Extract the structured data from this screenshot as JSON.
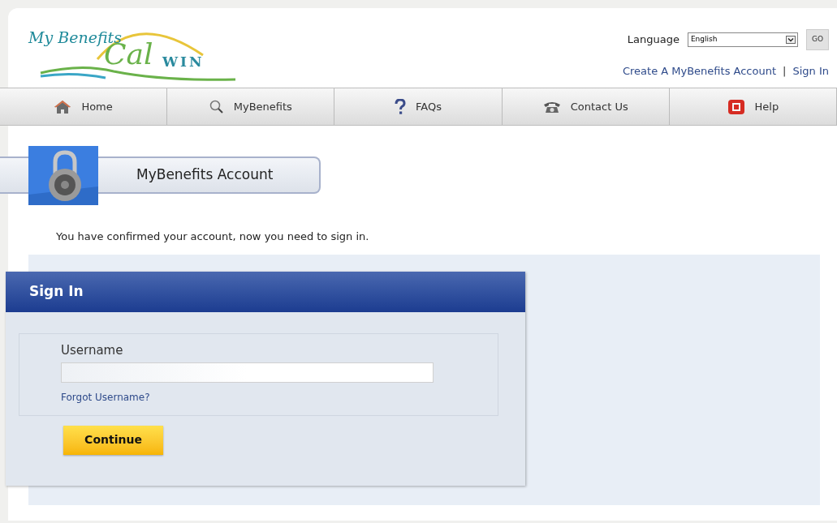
{
  "logo": {
    "script": "My Benefits",
    "brand_a": "Cal",
    "brand_b": "WIN"
  },
  "language": {
    "label": "Language",
    "value": "English",
    "go": "GO"
  },
  "top_links": [
    {
      "label": "Create A MyBenefits Account"
    },
    {
      "label": "Sign In"
    }
  ],
  "top_link_separator": "|",
  "nav": [
    {
      "label": "Home",
      "kind": "home"
    },
    {
      "label": "MyBenefits",
      "kind": "search"
    },
    {
      "label": "FAQs",
      "kind": "faq"
    },
    {
      "label": "Contact Us",
      "kind": "phone"
    },
    {
      "label": "Help",
      "kind": "help"
    }
  ],
  "banner": {
    "title": "MyBenefits Account"
  },
  "message": "You have confirmed your account, now you need to sign in.",
  "sign_in": {
    "title": "Sign In",
    "username_label": "Username",
    "forgot": "Forgot Username?",
    "button": "Continue"
  }
}
